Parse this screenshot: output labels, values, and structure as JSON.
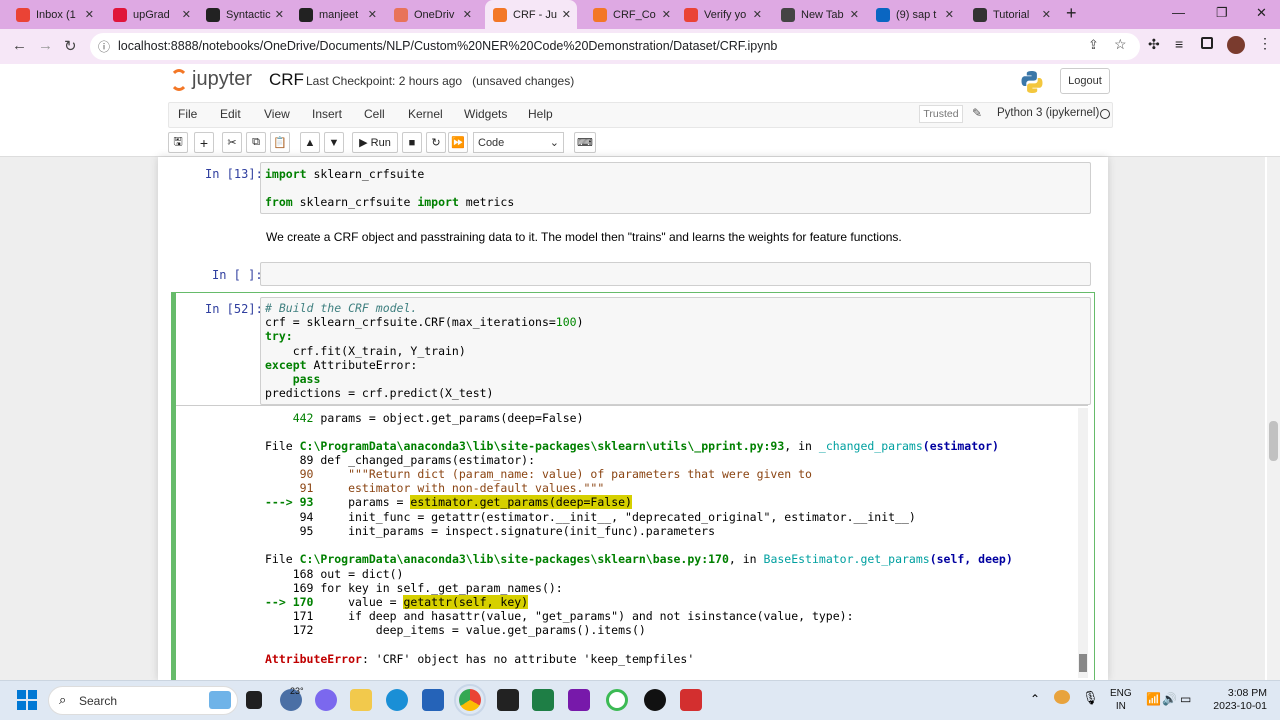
{
  "browser": {
    "tabs": [
      {
        "label": "Inbox (1",
        "icon": "gmail-icon",
        "color": "#ea4335"
      },
      {
        "label": "upGrad",
        "icon": "upgrad-icon",
        "color": "#e0153a"
      },
      {
        "label": "Syntactic",
        "icon": "github-icon",
        "color": "#222222"
      },
      {
        "label": "manjeet",
        "icon": "github-icon",
        "color": "#222222"
      },
      {
        "label": "OneDriv",
        "icon": "onedrive-icon",
        "color": "#e8735a"
      },
      {
        "label": "CRF - Ju",
        "icon": "jupyter-icon",
        "color": "#f37726"
      },
      {
        "label": "CRF_Co",
        "icon": "jupyter-icon",
        "color": "#f37726"
      },
      {
        "label": "Verify yo",
        "icon": "gmail-icon",
        "color": "#ea4335"
      },
      {
        "label": "New Tab",
        "icon": "chrome-icon",
        "color": "#444444"
      },
      {
        "label": "(9) sap t",
        "icon": "linkedin-icon",
        "color": "#0a66c2"
      },
      {
        "label": "Tutorial",
        "icon": "doc-icon",
        "color": "#333333"
      }
    ],
    "url": "localhost:8888/notebooks/OneDrive/Documents/NLP/Custom%20NER%20Code%20Demonstration/Dataset/CRF.ipynb"
  },
  "jupyter": {
    "logo_text": "jupyter",
    "notebook_name": "CRF",
    "checkpoint": "Last Checkpoint: 2 hours ago",
    "unsaved": "(unsaved changes)",
    "logout": "Logout",
    "menus": [
      "File",
      "Edit",
      "View",
      "Insert",
      "Cell",
      "Kernel",
      "Widgets",
      "Help"
    ],
    "trusted": "Trusted",
    "kernel": "Python 3 (ipykernel)",
    "run_label": "Run",
    "cell_type": "Code"
  },
  "cells": {
    "c1_prompt": "In [13]:",
    "c1_line1_kw": "import",
    "c1_line1_rest": " sklearn_crfsuite",
    "c1_line2_kw1": "from",
    "c1_line2_mid": " sklearn_crfsuite ",
    "c1_line2_kw2": "import",
    "c1_line2_rest": " metrics",
    "markdown": "We create a CRF object and passtraining data to it. The model then \"trains\" and learns the weights for feature functions.",
    "c2_prompt": "In [ ]:",
    "c3_prompt": "In [52]:",
    "c3_comment": "# Build the CRF model.",
    "c3_l2a": "crf = sklearn_crfsuite.CRF(max_iterations=",
    "c3_l2num": "100",
    "c3_l2b": ")",
    "c3_try": "try:",
    "c3_fit": "    crf.fit(X_train, Y_train)",
    "c3_except": "except",
    "c3_except_rest": " AttributeError:",
    "c3_pass": "    pass",
    "c3_pred": "predictions = crf.predict(X_test)"
  },
  "traceback": {
    "l442_num": "    442",
    "l442_code": " params = object.get_params(deep=False)",
    "file1_a": "File ",
    "file1_path": "C:\\ProgramData\\anaconda3\\lib\\site-packages\\sklearn\\utils\\_pprint.py:93",
    "file1_b": ", in ",
    "file1_func": "_changed_params",
    "file1_args": "(estimator)",
    "l89": "     89 def _changed_params(estimator):",
    "l90": "     90     \"\"\"Return dict (param_name: value) of parameters that were given to",
    "l91": "     91     estimator with non-default values.\"\"\"",
    "l93_arrow": "---> 93",
    "l93_pre": "     params = ",
    "l93_hl": "estimator.get_params(deep=False)",
    "l94": "     94     init_func = getattr(estimator.__init__, \"deprecated_original\", estimator.__init__)",
    "l95": "     95     init_params = inspect.signature(init_func).parameters",
    "file2_a": "File ",
    "file2_path": "C:\\ProgramData\\anaconda3\\lib\\site-packages\\sklearn\\base.py:170",
    "file2_b": ", in ",
    "file2_func": "BaseEstimator.get_params",
    "file2_args": "(self, deep)",
    "l168": "    168 out = dict()",
    "l169": "    169 for key in self._get_param_names():",
    "l170_arrow": "--> 170",
    "l170_pre": "     value = ",
    "l170_hl": "getattr(self, key)",
    "l171": "    171     if deep and hasattr(value, \"get_params\") and not isinstance(value, type):",
    "l172": "    172         deep_items = value.get_params().items()",
    "err_type": "AttributeError",
    "err_msg": ": 'CRF' object has no attribute 'keep_tempfiles'"
  },
  "taskbar": {
    "search": "Search",
    "temp": "23°",
    "lang1": "ENG",
    "lang2": "IN",
    "time": "3:08 PM",
    "date": "2023-10-01"
  }
}
